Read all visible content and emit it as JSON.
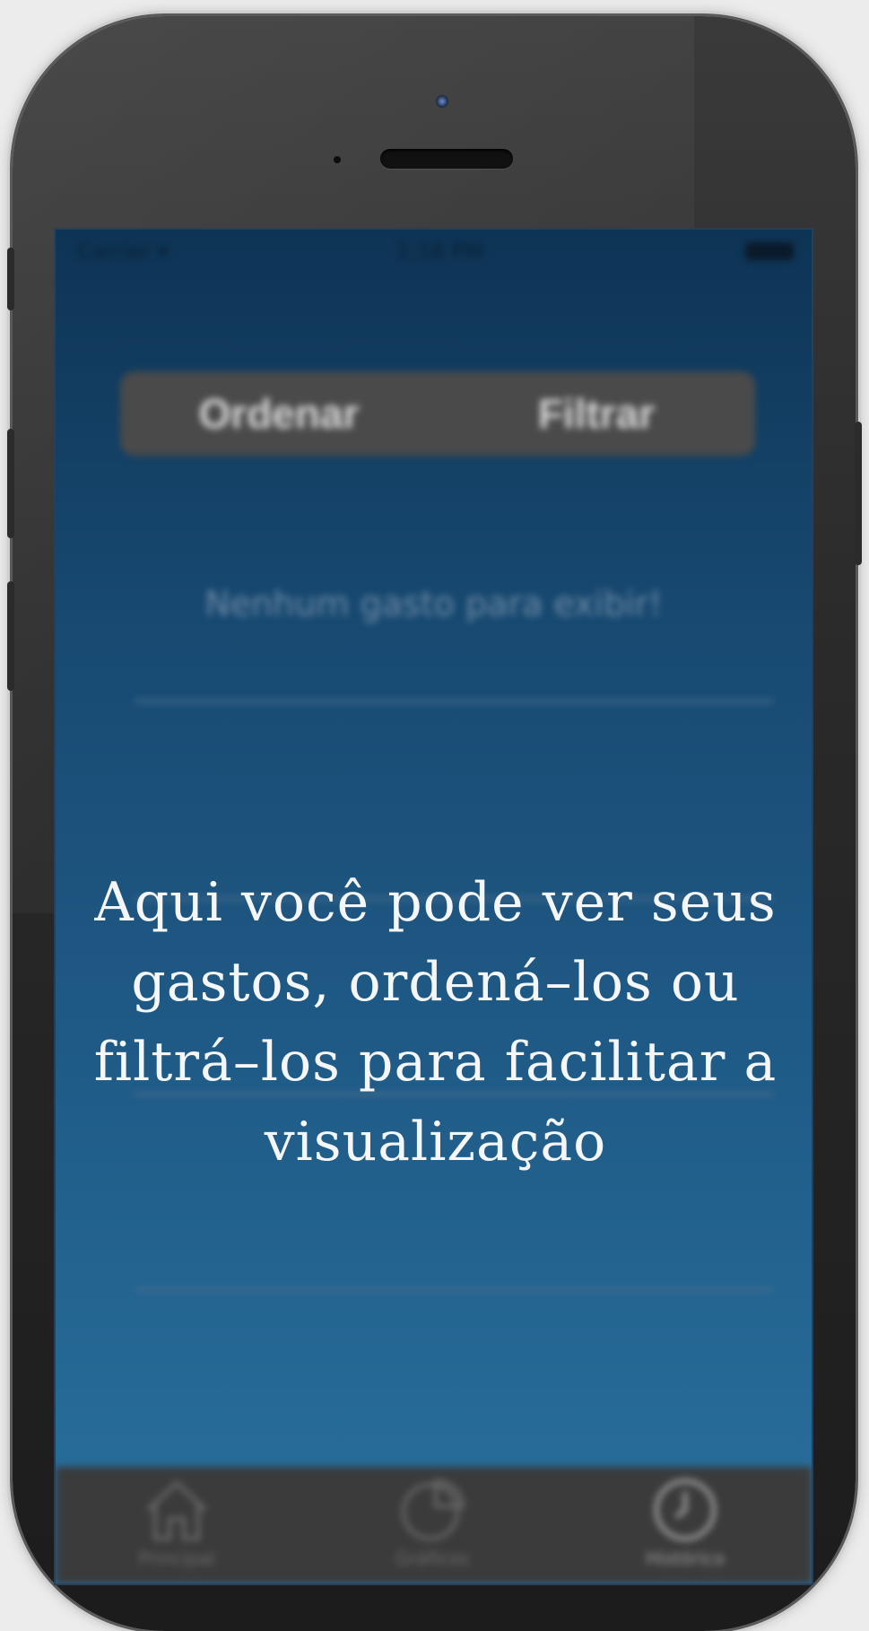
{
  "status_bar": {
    "carrier": "Carrier ▾",
    "time": "1:18 PM"
  },
  "segmented_control": {
    "sort_label": "Ordenar",
    "filter_label": "Filtrar"
  },
  "list": {
    "empty_message": "Nenhum gasto para exibir!"
  },
  "tab_bar": {
    "items": [
      {
        "label": "Principal",
        "icon": "home-icon"
      },
      {
        "label": "Gráficos",
        "icon": "pie-chart-icon"
      },
      {
        "label": "Histórico",
        "icon": "clock-icon",
        "active": true
      }
    ]
  },
  "tutorial_overlay": {
    "message": "Aqui você pode ver seus gastos, ordená–los ou filtrá–los para facilitar a visualização"
  },
  "colors": {
    "screen_top": "#0e3455",
    "screen_bottom": "#276b98",
    "segmented_bg": "#4a4a4a",
    "tab_bar_bg": "#3b3b3b"
  }
}
